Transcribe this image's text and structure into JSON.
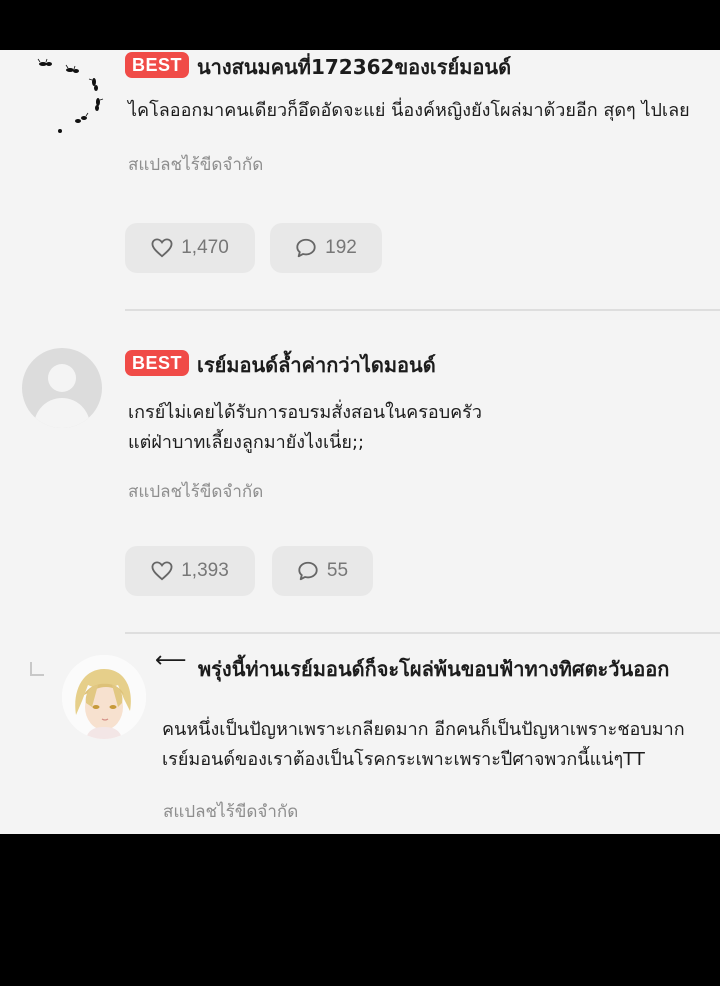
{
  "comments": [
    {
      "badge": "BEST",
      "username": "นางสนมคนที่172362ของเรย์มอนด์",
      "text": [
        "ไคโลออกมาคนเดียวก็อึดอัดจะแย่ นี่องค์หญิงยังโผล่มาด้วยอีก สุดๆ ไปเลย"
      ],
      "translate": "สแปลชไร้ขีดจำกัด",
      "likes": "1,470",
      "replies": "192",
      "avatar": "ants-avatar"
    },
    {
      "badge": "BEST",
      "username": "เรย์มอนด์ล้ำค่ากว่าไดมอนด์",
      "text": [
        "เกรย์ไม่เคยได้รับการอบรมสั่งสอนในครอบครัว",
        "แต่ฝ่าบาทเลี้ยงลูกมายังไงเนี่ย;;"
      ],
      "translate": "สแปลชไร้ขีดจำกัด",
      "likes": "1,393",
      "replies": "55",
      "avatar": "default-avatar"
    }
  ],
  "reply": {
    "arrow": "⟵",
    "username": "พรุ่งนี้ท่านเรย์มอนด์ก็จะโผล่พ้นขอบฟ้าทางทิศตะวันออก",
    "text": [
      "คนหนึ่งเป็นปัญหาเพราะเกลียดมาก อีกคนก็เป็นปัญหาเพราะชอบมาก",
      "เรย์มอนด์ของเราต้องเป็นโรคกระเพาะเพราะปีศาจพวกนี้แน่ๆTT"
    ],
    "translate": "สแปลชไร้ขีดจำกัด",
    "avatar": "anime-avatar"
  },
  "icons": {
    "like": "heart-icon",
    "reply": "speech-bubble-icon"
  },
  "colors": {
    "badge": "#f04b47",
    "page_bg": "#f4f4f4",
    "pill_bg": "#e8e8e8"
  }
}
